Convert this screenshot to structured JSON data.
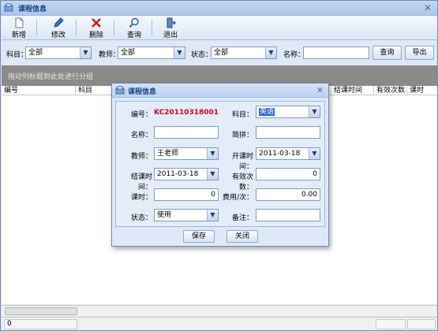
{
  "window": {
    "title": "课程信息"
  },
  "toolbar": {
    "new_label": "新增",
    "edit_label": "修改",
    "delete_label": "删除",
    "query_label": "查询",
    "exit_label": "退出"
  },
  "filters": {
    "subject_label": "科目：",
    "subject_value": "全部",
    "teacher_label": "教师：",
    "teacher_value": "全部",
    "status_label": "状态：",
    "status_value": "全部",
    "name_label": "名称：",
    "name_value": "",
    "query_button": "查询",
    "export_button": "导出"
  },
  "grid": {
    "group_hint": "拖动列标题到此处进行分组",
    "columns_left": [
      "编号",
      "科目"
    ],
    "columns_right": [
      "结课时间",
      "有效次数",
      "课时"
    ]
  },
  "footer": {
    "count": "0"
  },
  "dialog": {
    "title": "课程信息",
    "code_label": "编号：",
    "code_value": "KC20110318001",
    "subject_label": "科目：",
    "subject_value": "英语",
    "name_label": "名称：",
    "name_value": "",
    "abbr_label": "简拼：",
    "abbr_value": "",
    "teacher_label": "教师：",
    "teacher_value": "王老师",
    "start_label": "开课时间：",
    "start_value": "2011-03-18",
    "end_label": "结课时间：",
    "end_value": "2011-03-18",
    "valid_label": "有效次数：",
    "valid_value": "0",
    "hours_label": "课时：",
    "hours_value": "0",
    "fee_label": "费用/次：",
    "fee_value": "0.00",
    "status_label": "状态：",
    "status_value": "使用",
    "remark_label": "备注：",
    "remark_value": "",
    "save_button": "保存",
    "close_button": "关闭"
  },
  "colors": {
    "accent": "#15428b",
    "code_red": "#e0001b",
    "selection": "#316ac5"
  }
}
